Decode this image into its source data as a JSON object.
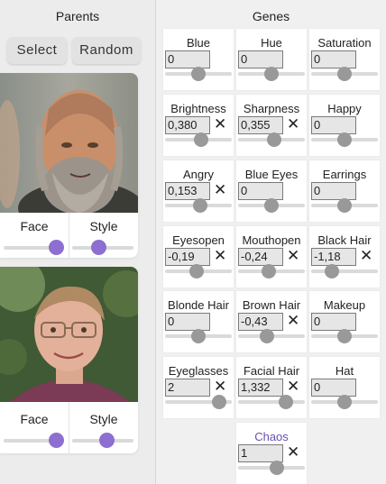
{
  "parents": {
    "title": "Parents",
    "select_label": "Select",
    "random_label": "Random",
    "cards": [
      {
        "face_label": "Face",
        "style_label": "Style",
        "face_level": 0.86,
        "style_level": 0.42
      },
      {
        "face_label": "Face",
        "style_label": "Style",
        "face_level": 0.86,
        "style_level": 0.55
      }
    ]
  },
  "genes": {
    "title": "Genes",
    "items": [
      {
        "name": "Blue",
        "value": "0",
        "level": 0.5,
        "has_x": false
      },
      {
        "name": "Hue",
        "value": "0",
        "level": 0.5,
        "has_x": false
      },
      {
        "name": "Saturation",
        "value": "0",
        "level": 0.5,
        "has_x": false
      },
      {
        "name": "Brightness",
        "value": "0,380",
        "level": 0.55,
        "has_x": true
      },
      {
        "name": "Sharpness",
        "value": "0,355",
        "level": 0.55,
        "has_x": true
      },
      {
        "name": "Happy",
        "value": "0",
        "level": 0.5,
        "has_x": false
      },
      {
        "name": "Angry",
        "value": "0,153",
        "level": 0.53,
        "has_x": true
      },
      {
        "name": "Blue Eyes",
        "value": "0",
        "level": 0.5,
        "has_x": false
      },
      {
        "name": "Earrings",
        "value": "0",
        "level": 0.5,
        "has_x": false
      },
      {
        "name": "Eyesopen",
        "value": "-0,19",
        "level": 0.46,
        "has_x": true
      },
      {
        "name": "Mouthopen",
        "value": "-0,24",
        "level": 0.44,
        "has_x": true
      },
      {
        "name": "Black Hair",
        "value": "-1,18",
        "level": 0.26,
        "has_x": true
      },
      {
        "name": "Blonde Hair",
        "value": "0",
        "level": 0.5,
        "has_x": false
      },
      {
        "name": "Brown Hair",
        "value": "-0,43",
        "level": 0.42,
        "has_x": true
      },
      {
        "name": "Makeup",
        "value": "0",
        "level": 0.5,
        "has_x": false
      },
      {
        "name": "Eyeglasses",
        "value": "2",
        "level": 0.9,
        "has_x": true
      },
      {
        "name": "Facial Hair",
        "value": "1,332",
        "level": 0.77,
        "has_x": true
      },
      {
        "name": "Hat",
        "value": "0",
        "level": 0.5,
        "has_x": false
      },
      {
        "name": "Chaos",
        "value": "1",
        "level": 0.6,
        "has_x": true,
        "accent": true
      }
    ]
  },
  "colors": {
    "accent": "#8c6fd0",
    "chaos_label": "#6a4fb3",
    "knob_gray": "#999999"
  },
  "icons": {
    "reset": "close-icon"
  }
}
